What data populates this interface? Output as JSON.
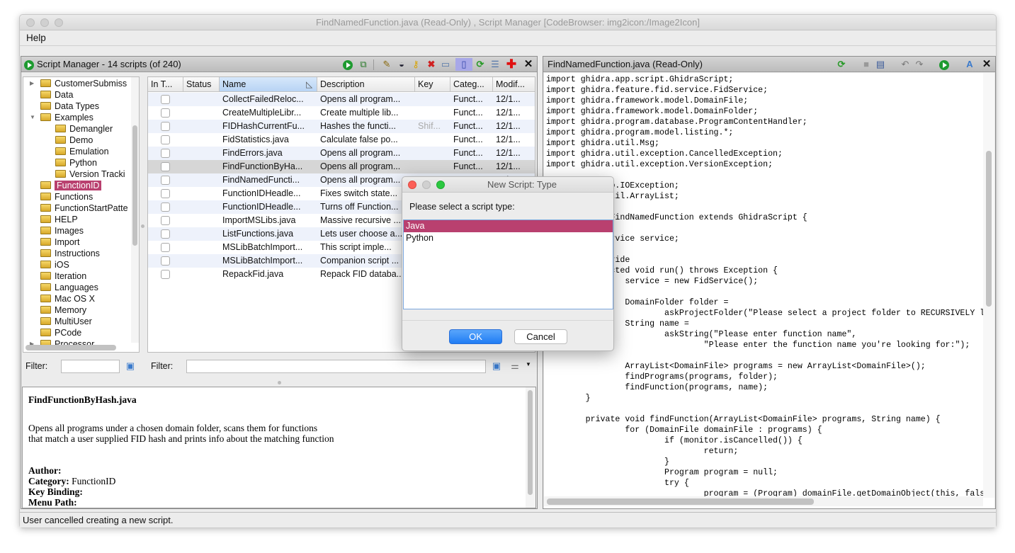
{
  "window": {
    "title": "FindNamedFunction.java (Read-Only) , Script Manager [CodeBrowser: img2icon:/Image2Icon]"
  },
  "menu": [
    "Help"
  ],
  "script_manager": {
    "title": "Script Manager - 14 scripts  (of 240)",
    "toolbar_icons": [
      "run-script-icon",
      "run-last-script-icon",
      "edit-script-icon",
      "edit-eclipse-icon",
      "key-binding-icon",
      "delete-script-icon",
      "rename-icon",
      "new-script-icon",
      "refresh-icon",
      "script-directories-icon",
      "help-icon",
      "close-icon"
    ],
    "tree": [
      {
        "label": "CustomerSubmiss",
        "level": 0,
        "arrow": "right"
      },
      {
        "label": "Data",
        "level": 0
      },
      {
        "label": "Data Types",
        "level": 0
      },
      {
        "label": "Examples",
        "level": 0,
        "arrow": "down"
      },
      {
        "label": "Demangler",
        "level": 1
      },
      {
        "label": "Demo",
        "level": 1
      },
      {
        "label": "Emulation",
        "level": 1
      },
      {
        "label": "Python",
        "level": 1
      },
      {
        "label": "Version Tracki",
        "level": 1
      },
      {
        "label": "FunctionID",
        "level": 0,
        "selected": true
      },
      {
        "label": "Functions",
        "level": 0
      },
      {
        "label": "FunctionStartPatte",
        "level": 0
      },
      {
        "label": "HELP",
        "level": 0
      },
      {
        "label": "Images",
        "level": 0
      },
      {
        "label": "Import",
        "level": 0
      },
      {
        "label": "Instructions",
        "level": 0
      },
      {
        "label": "iOS",
        "level": 0
      },
      {
        "label": "Iteration",
        "level": 0
      },
      {
        "label": "Languages",
        "level": 0
      },
      {
        "label": "Mac OS X",
        "level": 0
      },
      {
        "label": "Memory",
        "level": 0
      },
      {
        "label": "MultiUser",
        "level": 0
      },
      {
        "label": "PCode",
        "level": 0
      },
      {
        "label": "Processor",
        "level": 0,
        "arrow": "right"
      }
    ],
    "columns": [
      "In T...",
      "Status",
      "Name",
      "Description",
      "Key",
      "Categ...",
      "Modif..."
    ],
    "sorted_column": "Name",
    "rows": [
      {
        "name": "CollectFailedReloc...",
        "desc": "Opens all program...",
        "key": "",
        "cat": "Funct...",
        "mod": "12/1..."
      },
      {
        "name": "CreateMultipleLibr...",
        "desc": "Create multiple lib...",
        "key": "",
        "cat": "Funct...",
        "mod": "12/1..."
      },
      {
        "name": "FIDHashCurrentFu...",
        "desc": "Hashes the functi...",
        "key": "Shif...",
        "cat": "Funct...",
        "mod": "12/1..."
      },
      {
        "name": "FidStatistics.java",
        "desc": "Calculate false po...",
        "key": "",
        "cat": "Funct...",
        "mod": "12/1..."
      },
      {
        "name": "FindErrors.java",
        "desc": "Opens all program...",
        "key": "",
        "cat": "Funct...",
        "mod": "12/1..."
      },
      {
        "name": "FindFunctionByHa...",
        "desc": "Opens all program...",
        "key": "",
        "cat": "Funct...",
        "mod": "12/1...",
        "selected": true
      },
      {
        "name": "FindNamedFuncti...",
        "desc": "Opens all program...",
        "key": "",
        "cat": "Funct...",
        "mod": "12/1..."
      },
      {
        "name": "FunctionIDHeadle...",
        "desc": "Fixes switch state...",
        "key": "",
        "cat": "Funct...",
        "mod": "12/1..."
      },
      {
        "name": "FunctionIDHeadle...",
        "desc": "Turns off Function...",
        "key": "",
        "cat": "Funct...",
        "mod": "12/1..."
      },
      {
        "name": "ImportMSLibs.java",
        "desc": "Massive recursive ...",
        "key": "",
        "cat": "Funct...",
        "mod": "12/1..."
      },
      {
        "name": "ListFunctions.java",
        "desc": "Lets user choose a...",
        "key": "",
        "cat": "Funct...",
        "mod": "12/1..."
      },
      {
        "name": "MSLibBatchImport...",
        "desc": "This script imple...",
        "key": "",
        "cat": "Funct...",
        "mod": "12/1..."
      },
      {
        "name": "MSLibBatchImport...",
        "desc": "Companion script ...",
        "key": "",
        "cat": "Funct...",
        "mod": "12/1..."
      },
      {
        "name": "RepackFid.java",
        "desc": "Repack FID databa...",
        "key": "",
        "cat": "Funct...",
        "mod": "12/1..."
      }
    ],
    "tree_filter": {
      "label": "Filter:",
      "value": ""
    },
    "table_filter": {
      "label": "Filter:",
      "value": ""
    },
    "description": {
      "title": "FindFunctionByHash.java",
      "body_line1": "Opens all programs under a chosen domain folder, scans them for functions",
      "body_line2": "that match a user supplied FID hash and prints info about the matching function",
      "author_label": "Author:",
      "author": "",
      "category_label": "Category:",
      "category": "FunctionID",
      "keybinding_label": "Key Binding:",
      "keybinding": "",
      "menupath_label": "Menu Path:",
      "menupath": ""
    }
  },
  "editor": {
    "title": "FindNamedFunction.java (Read-Only)",
    "toolbar_icons": [
      "refresh-icon",
      "save-icon",
      "save-as-icon",
      "undo-icon",
      "redo-icon",
      "run-script-icon",
      "font-icon",
      "close-icon"
    ],
    "code": "import ghidra.app.script.GhidraScript;\nimport ghidra.feature.fid.service.FidService;\nimport ghidra.framework.model.DomainFile;\nimport ghidra.framework.model.DomainFolder;\nimport ghidra.program.database.ProgramContentHandler;\nimport ghidra.program.model.listing.*;\nimport ghidra.util.Msg;\nimport ghidra.util.exception.CancelledException;\nimport ghidra.util.exception.VersionException;\n\nimport java.io.IOException;\nimport java.util.ArrayList;\n\npublic class FindNamedFunction extends GhidraScript {\n\n\tFidService service;\n\n\t@Override\n\tprotected void run() throws Exception {\n\t\tservice = new FidService();\n\n\t\tDomainFolder folder =\n\t\t\taskProjectFolder(\"Please select a project folder to RECURSIVELY look for a named function:\");\n\t\tString name =\n\t\t\taskString(\"Please enter function name\",\n\t\t\t\t\"Please enter the function name you're looking for:\");\n\n\t\tArrayList<DomainFile> programs = new ArrayList<DomainFile>();\n\t\tfindPrograms(programs, folder);\n\t\tfindFunction(programs, name);\n\t}\n\n\tprivate void findFunction(ArrayList<DomainFile> programs, String name) {\n\t\tfor (DomainFile domainFile : programs) {\n\t\t\tif (monitor.isCancelled()) {\n\t\t\t\treturn;\n\t\t\t}\n\t\t\tProgram program = null;\n\t\t\ttry {\n\t\t\t\tprogram = (Program) domainFile.getDomainObject(this, false, false, monitor);"
  },
  "dialog": {
    "title": "New Script: Type",
    "prompt": "Please select a script type:",
    "options": [
      "Java",
      "Python"
    ],
    "selected": "Java",
    "ok": "OK",
    "cancel": "Cancel"
  },
  "status": "User cancelled creating a new script.",
  "colors": {
    "selection": "#b9406f",
    "ok_button": "#2a84f7",
    "run_green": "#1e9a30",
    "row_stripe": "#eef2fb",
    "selected_row": "#d6d6d6"
  }
}
